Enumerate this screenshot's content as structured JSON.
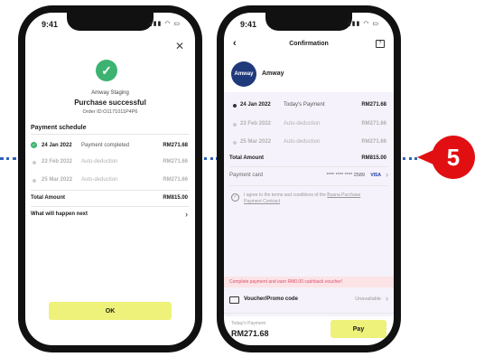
{
  "step_badge": "5",
  "screen1": {
    "time": "9:41",
    "close_icon": "close-icon",
    "merchant": "Amway Staging",
    "title": "Purchase successful",
    "order_id": "Order ID:O1171011P4P6",
    "schedule_title": "Payment schedule",
    "rows": [
      {
        "date": "24 Jan 2022",
        "desc": "Payment completed",
        "amount": "RM271.68"
      },
      {
        "date": "23 Feb 2022",
        "desc": "Auto-deduction",
        "amount": "RM271.66"
      },
      {
        "date": "25 Mar 2022",
        "desc": "Auto-deduction",
        "amount": "RM271.66"
      }
    ],
    "total_label": "Total Amount",
    "total_value": "RM815.00",
    "next_label": "What will happen next",
    "ok_label": "OK"
  },
  "screen2": {
    "time": "9:41",
    "title": "Confirmation",
    "logo_text": "Amway",
    "merchant": "Amway",
    "rows": [
      {
        "date": "24 Jan 2022",
        "desc": "Today's Payment",
        "amount": "RM271.68"
      },
      {
        "date": "23 Feb 2022",
        "desc": "Auto-deduction",
        "amount": "RM271.66"
      },
      {
        "date": "25 Mar 2022",
        "desc": "Auto-deduction",
        "amount": "RM271.66"
      }
    ],
    "total_label": "Total Amount",
    "total_value": "RM815.00",
    "card_label": "Payment card",
    "card_number": "**** **** **** 2589",
    "card_brand": "VISA",
    "terms_prefix": "I agree to the terms and conditions of the",
    "terms_link": "Buana Purchase Payment Contract",
    "cashback_banner": "Complete payment and earn RM0.00 cashback voucher!",
    "voucher_label": "Voucher/Promo code",
    "voucher_status": "Unavailable",
    "today_label": "Today's Payment",
    "today_amount": "RM271.68",
    "pay_label": "Pay"
  },
  "colors": {
    "accent_yellow": "#eef27a",
    "success_green": "#3cb371",
    "badge_red": "#e10f12",
    "dotted_blue": "#2f63b8"
  }
}
